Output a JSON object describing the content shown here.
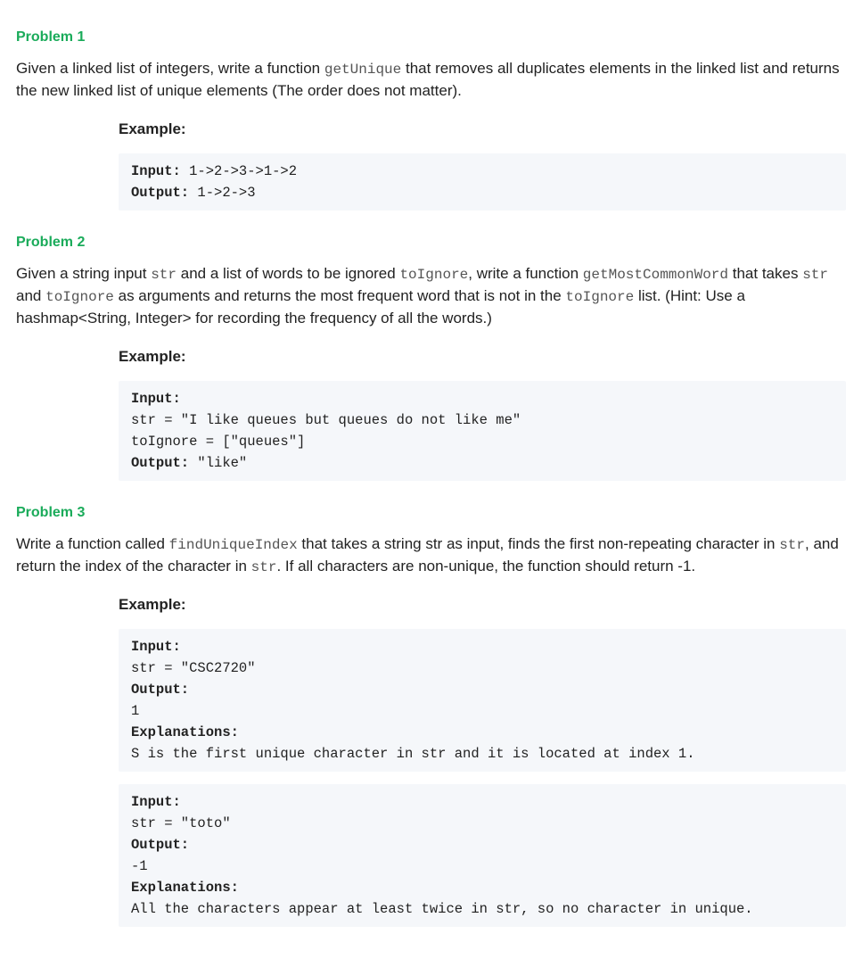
{
  "problems": [
    {
      "heading": "Problem 1",
      "desc_parts": [
        {
          "t": "text",
          "v": "Given a linked list of integers, write a function "
        },
        {
          "t": "code",
          "v": "getUnique"
        },
        {
          "t": "text",
          "v": " that removes all duplicates elements in the linked list and returns the new linked list of unique elements (The order does not matter)."
        }
      ],
      "example_label": "Example:",
      "code_blocks": [
        [
          {
            "bold": true,
            "text": "Input:"
          },
          {
            "bold": false,
            "text": " 1->2->3->1->2\n"
          },
          {
            "bold": true,
            "text": "Output:"
          },
          {
            "bold": false,
            "text": " 1->2->3"
          }
        ]
      ]
    },
    {
      "heading": "Problem 2",
      "desc_parts": [
        {
          "t": "text",
          "v": "Given a string input "
        },
        {
          "t": "code",
          "v": "str"
        },
        {
          "t": "text",
          "v": " and a list of words to be ignored "
        },
        {
          "t": "code",
          "v": "toIgnore"
        },
        {
          "t": "text",
          "v": ", write a function "
        },
        {
          "t": "code",
          "v": "getMostCommonWord"
        },
        {
          "t": "text",
          "v": " that takes "
        },
        {
          "t": "code",
          "v": "str"
        },
        {
          "t": "text",
          "v": " and "
        },
        {
          "t": "code",
          "v": "toIgnore"
        },
        {
          "t": "text",
          "v": " as arguments and returns the most frequent word that is not in the "
        },
        {
          "t": "code",
          "v": "toIgnore"
        },
        {
          "t": "text",
          "v": "  list. (Hint: Use a hashmap<String, Integer> for recording the frequency of all the words.)"
        }
      ],
      "example_label": "Example:",
      "code_blocks": [
        [
          {
            "bold": true,
            "text": "Input:\n"
          },
          {
            "bold": false,
            "text": "str = \"I like queues but queues do not like me\"\ntoIgnore = [\"queues\"]\n"
          },
          {
            "bold": true,
            "text": "Output:"
          },
          {
            "bold": false,
            "text": " \"like\""
          }
        ]
      ]
    },
    {
      "heading": "Problem 3",
      "desc_parts": [
        {
          "t": "text",
          "v": "Write a function called "
        },
        {
          "t": "code",
          "v": "findUniqueIndex"
        },
        {
          "t": "text",
          "v": " that takes a string str as input, finds the first non-repeating character in "
        },
        {
          "t": "code",
          "v": "str"
        },
        {
          "t": "text",
          "v": ", and return the index of the character in "
        },
        {
          "t": "code",
          "v": "str"
        },
        {
          "t": "text",
          "v": ". If all characters are non-unique, the function should return -1."
        }
      ],
      "example_label": "Example:",
      "code_blocks": [
        [
          {
            "bold": true,
            "text": "Input:\n"
          },
          {
            "bold": false,
            "text": "str = \"CSC2720\"\n"
          },
          {
            "bold": true,
            "text": "Output:\n"
          },
          {
            "bold": false,
            "text": "1\n"
          },
          {
            "bold": true,
            "text": "Explanations:\n"
          },
          {
            "bold": false,
            "text": "S is the first unique character in str and it is located at index 1."
          }
        ],
        [
          {
            "bold": true,
            "text": "Input:\n"
          },
          {
            "bold": false,
            "text": "str = \"toto\"\n"
          },
          {
            "bold": true,
            "text": "Output:\n"
          },
          {
            "bold": false,
            "text": "-1\n"
          },
          {
            "bold": true,
            "text": "Explanations:\n"
          },
          {
            "bold": false,
            "text": "All the characters appear at least twice in str, so no character in unique."
          }
        ]
      ]
    }
  ]
}
